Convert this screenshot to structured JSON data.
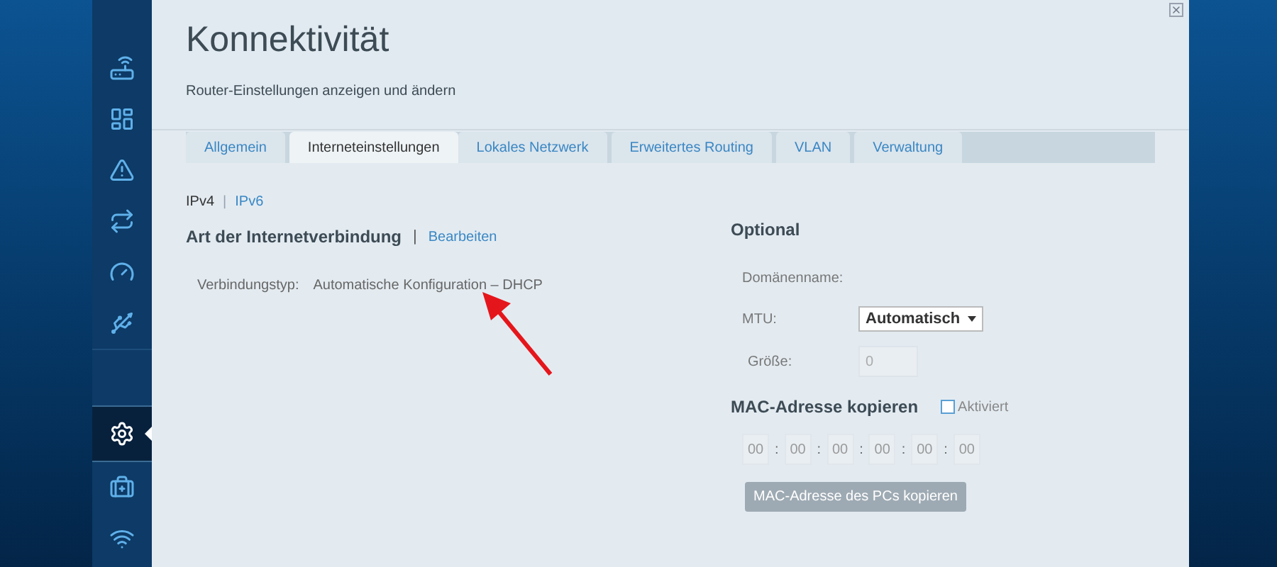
{
  "sidebar": {
    "items": [
      {
        "selected": false
      },
      {
        "selected": false
      },
      {
        "selected": false
      },
      {
        "selected": false
      },
      {
        "selected": false
      },
      {
        "selected": false
      },
      {
        "selected": true
      },
      {
        "selected": false
      },
      {
        "selected": false
      }
    ]
  },
  "header": {
    "title": "Konnektivität",
    "subtitle": "Router-Einstellungen anzeigen und ändern"
  },
  "tabs": [
    {
      "label": "Allgemein",
      "selected": false
    },
    {
      "label": "Interneteinstellungen",
      "selected": true
    },
    {
      "label": "Lokales Netzwerk",
      "selected": false
    },
    {
      "label": "Erweitertes Routing",
      "selected": false
    },
    {
      "label": "VLAN",
      "selected": false
    },
    {
      "label": "Verwaltung",
      "selected": false
    }
  ],
  "ip_separator": "|",
  "ip_switch": [
    {
      "label": "IPv4",
      "selected": true
    },
    {
      "label": "IPv6",
      "selected": false
    }
  ],
  "connection": {
    "heading": "Art der Internetverbindung",
    "separator": "|",
    "edit_link": "Bearbeiten",
    "type_label": "Verbindungstyp:",
    "type_value": "Automatische Konfiguration – DHCP"
  },
  "optional": {
    "heading": "Optional",
    "domain_label": "Domänenname:",
    "mtu_label": "MTU:",
    "mtu_value": "Automatisch",
    "size_label": "Größe:",
    "size_value": "0",
    "size_disabled": true
  },
  "mac": {
    "heading": "MAC-Adresse kopieren",
    "checkbox_label": "Aktiviert",
    "checked": false,
    "separator": ":",
    "octets": [
      "00",
      "00",
      "00",
      "00",
      "00",
      "00"
    ],
    "disabled": true,
    "button": "MAC-Adresse des PCs kopieren"
  }
}
